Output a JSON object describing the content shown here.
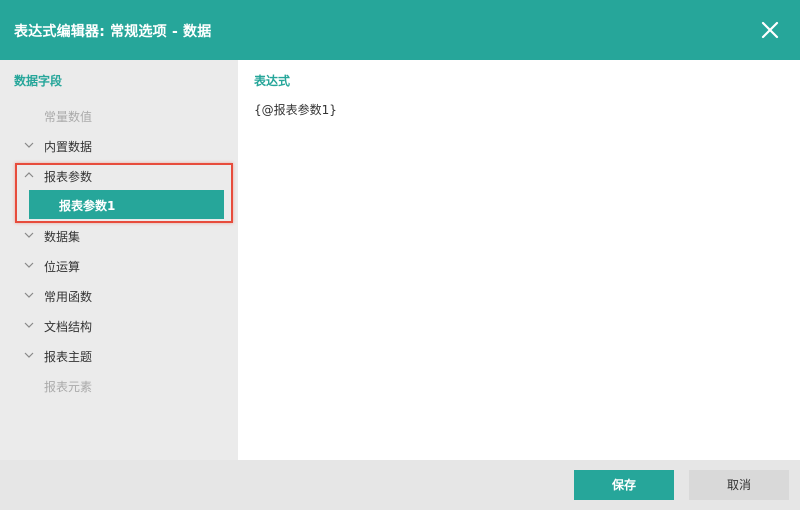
{
  "dialog": {
    "title": "表达式编辑器: 常规选项 - 数据",
    "close_icon": "close-icon",
    "accent_color": "#26a69a"
  },
  "sidebar": {
    "title": "数据字段",
    "items": [
      {
        "label": "常量数值",
        "expandable": false,
        "disabled": true
      },
      {
        "label": "内置数据",
        "expandable": true,
        "expanded": false
      },
      {
        "label": "报表参数",
        "expandable": true,
        "expanded": true,
        "children": [
          {
            "label": "报表参数1",
            "selected": true
          }
        ]
      },
      {
        "label": "数据集",
        "expandable": true,
        "expanded": false
      },
      {
        "label": "位运算",
        "expandable": true,
        "expanded": false
      },
      {
        "label": "常用函数",
        "expandable": true,
        "expanded": false
      },
      {
        "label": "文档结构",
        "expandable": true,
        "expanded": false
      },
      {
        "label": "报表主题",
        "expandable": true,
        "expanded": false
      },
      {
        "label": "报表元素",
        "expandable": false,
        "disabled": true
      }
    ]
  },
  "expression": {
    "title": "表达式",
    "value": "{@报表参数1}"
  },
  "footer": {
    "save_label": "保存",
    "cancel_label": "取消"
  }
}
